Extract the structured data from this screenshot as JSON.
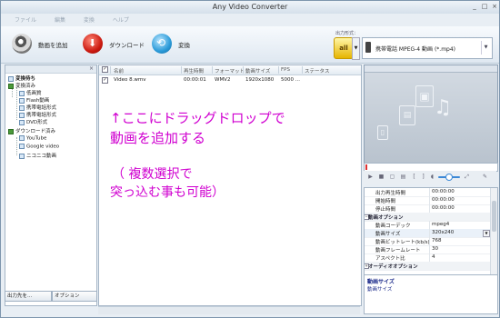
{
  "window": {
    "title": "Any Video Converter",
    "minimize": "_",
    "maximize": "□",
    "close": "×"
  },
  "menu": [
    "ファイル",
    "編集",
    "変換",
    "ヘルプ"
  ],
  "toolbar": {
    "add_label": "動画を追加",
    "download_label": "ダウンロード",
    "convert_label": "変換"
  },
  "output": {
    "label": "出力形式：",
    "icon_text": "all",
    "profile": "携帯電話 MPEG-4 動画 (*.mp4)"
  },
  "sidebar": {
    "root": "変換待ち",
    "groups": [
      {
        "label": "変換済み",
        "items": [
          "低画質",
          "Flash動画",
          "携帯電話形式",
          "携帯電話形式",
          "DVD形式"
        ]
      },
      {
        "label": "ダウンロード済み",
        "items": [
          "YouTube",
          "Google video",
          "ニコニコ動画"
        ]
      }
    ],
    "footer_tabs": [
      "出力先を...",
      "オプション"
    ]
  },
  "table": {
    "columns": [
      "",
      "名前",
      "再生時間",
      "フォーマット",
      "動画サイズ",
      "FPS",
      "ステータス"
    ],
    "rows": [
      {
        "checked": "✓",
        "name": "Video 8.wmv",
        "duration": "00:00:01",
        "format": "WMV2",
        "size": "1920x1080",
        "fps": "5000 ...",
        "status": ""
      }
    ]
  },
  "overlay": {
    "line1": "↑ここにドラッグドロップで",
    "line2": "動画を追加する",
    "line3": "（ 複数選択で",
    "line4": "突っ込む事も可能）"
  },
  "properties": {
    "rows": [
      {
        "key": "出力再生時間",
        "value": "00:00:00"
      },
      {
        "key": "開始時間",
        "value": "00:00:00"
      },
      {
        "key": "停止時間",
        "value": "00:00:00"
      },
      {
        "key": "動画オプション",
        "value": ""
      },
      {
        "key": "動画コーデック",
        "value": "mpeg4"
      },
      {
        "key": "動画サイズ",
        "value": "320x240"
      },
      {
        "key": "動画ビットレート(kb/s)",
        "value": "768"
      },
      {
        "key": "動画フレームレート",
        "value": "30"
      },
      {
        "key": "アスペクト比",
        "value": "4"
      },
      {
        "key": "オーディオオプション",
        "value": ""
      }
    ],
    "description_title": "動画サイズ",
    "description_text": "動画サイズ"
  },
  "colors": {
    "overlay": "#d000d0",
    "accent": "#3b88d6"
  }
}
